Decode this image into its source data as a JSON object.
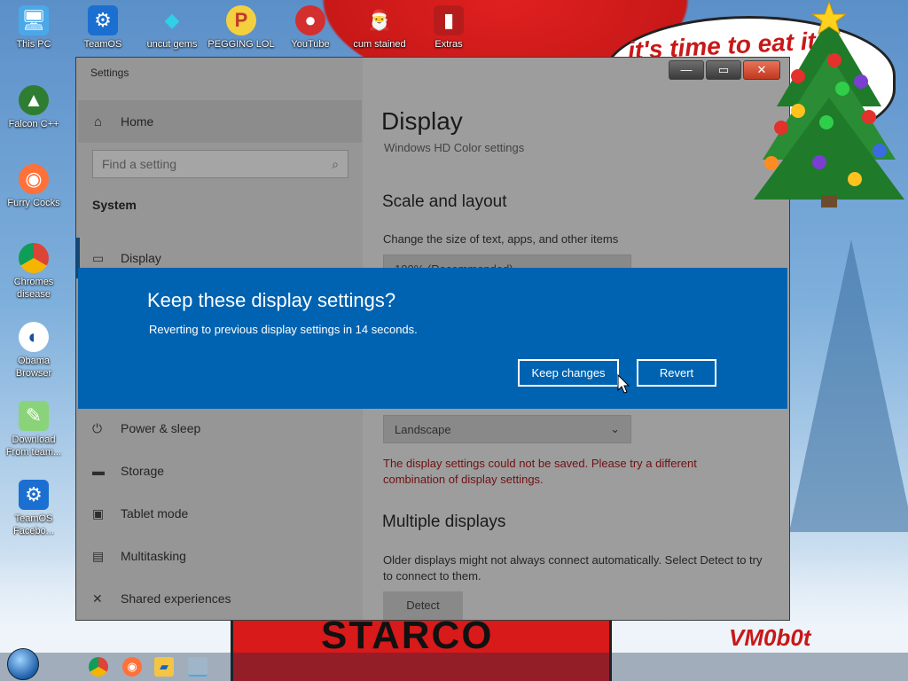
{
  "wallpaper": {
    "bubble_text": "it's time to eat it",
    "shirt_text": "STARCO",
    "signature": "VM0b0t"
  },
  "desktop_icons": [
    {
      "label": "This PC",
      "icon": "computer-icon"
    },
    {
      "label": "TeamOS",
      "icon": "gear-icon"
    },
    {
      "label": "uncut gems",
      "icon": "gem-icon"
    },
    {
      "label": "PEGGING LOL",
      "icon": "p-logo-icon"
    },
    {
      "label": "YouTube",
      "icon": "angry-bird-icon"
    },
    {
      "label": "cum stained",
      "icon": "santa-icon"
    },
    {
      "label": "Extras",
      "icon": "extras-icon"
    },
    {
      "label": "Falcon C++",
      "icon": "falcon-icon"
    },
    {
      "label": "Furry Cocks",
      "icon": "firefox-icon"
    },
    {
      "label": "Chromes disease",
      "icon": "chrome-icon"
    },
    {
      "label": "Obama Browser",
      "icon": "obama-logo-icon"
    },
    {
      "label": "Download From team...",
      "icon": "notepad-icon"
    },
    {
      "label": "TeamOS Facebo...",
      "icon": "gear-icon"
    }
  ],
  "settings": {
    "window_title": "Settings",
    "controls": {
      "minimize": "—",
      "maximize": "▭",
      "close": "✕"
    },
    "home_label": "Home",
    "search_placeholder": "Find a setting",
    "section_label": "System",
    "nav": [
      {
        "label": "Display",
        "icon": "monitor-icon",
        "active": true
      },
      {
        "label": "Power & sleep",
        "icon": "power-icon"
      },
      {
        "label": "Storage",
        "icon": "storage-icon"
      },
      {
        "label": "Tablet mode",
        "icon": "tablet-icon"
      },
      {
        "label": "Multitasking",
        "icon": "multitasking-icon"
      },
      {
        "label": "Shared experiences",
        "icon": "shared-icon"
      }
    ],
    "page_title": "Display",
    "hd_color_link": "Windows HD Color settings",
    "scale_heading": "Scale and layout",
    "scale_desc": "Change the size of text, apps, and other items",
    "scale_value": "100% (Recommended)",
    "orientation_value": "Landscape",
    "error_text": "The display settings could not be saved. Please try a different combination of display settings.",
    "multi_heading": "Multiple displays",
    "multi_desc": "Older displays might not always connect automatically. Select Detect to try to connect to them.",
    "detect_label": "Detect"
  },
  "dialog": {
    "title": "Keep these display settings?",
    "message": "Reverting to previous display settings in 14 seconds.",
    "keep_label": "Keep changes",
    "revert_label": "Revert",
    "background": "#0063b1"
  }
}
